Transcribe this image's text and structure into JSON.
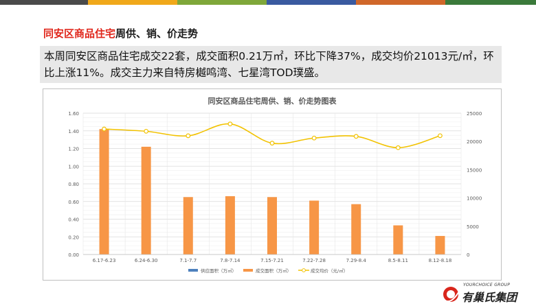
{
  "header": {
    "title_highlight": "同安区商品住宅",
    "title_rest": "周供、销、价走势"
  },
  "summary": {
    "text": "本周同安区商品住宅成交22套，成交面积0.21万㎡，环比下降37%，成交均价21013元/㎡，环比上涨11%。成交主力来自特房樾鸣湾、七星湾TOD璞盛。"
  },
  "chart_data": {
    "type": "bar",
    "title": "同安区商品住宅周供、销、价走势图表",
    "categories": [
      "6.17-6.23",
      "6.24-6.30",
      "7.1-7.7",
      "7.8-7.14",
      "7.15-7.21",
      "7.22-7.28",
      "7.29-8.4",
      "8.5-8.11",
      "8.12-8.18"
    ],
    "left_axis": {
      "ylim": [
        0,
        1.6
      ],
      "ticks": [
        "0.00",
        "0.20",
        "0.40",
        "0.60",
        "0.80",
        "1.00",
        "1.20",
        "1.40",
        "1.60"
      ]
    },
    "right_axis": {
      "ylim": [
        0,
        25000
      ],
      "ticks": [
        "0",
        "5000",
        "10000",
        "15000",
        "20000",
        "25000"
      ]
    },
    "series": [
      {
        "name": "供应面积（万㎡）",
        "kind": "bar",
        "axis": "left",
        "color": "#4e81bd",
        "values": [
          0,
          0,
          0,
          0,
          0,
          0,
          0,
          0,
          0
        ]
      },
      {
        "name": "成交面积（万㎡）",
        "kind": "bar",
        "axis": "left",
        "color": "#f79646",
        "values": [
          1.42,
          1.22,
          0.65,
          0.66,
          0.65,
          0.61,
          0.57,
          0.33,
          0.21
        ]
      },
      {
        "name": "成交均价（元/㎡）",
        "kind": "line",
        "axis": "right",
        "color": "#f2c200",
        "values": [
          22200,
          21800,
          21000,
          23100,
          19700,
          20600,
          20900,
          18900,
          21013
        ]
      }
    ],
    "grid": true,
    "legend": "bottom"
  },
  "logo": {
    "en": "YOURCHOICE GROUP",
    "cn": "有巢氏集团",
    "colors": {
      "mark": "#d9261c"
    }
  },
  "topbar_colors": [
    "#4a4a4a",
    "#f0a81a",
    "#7fa73a",
    "#3a5aa0",
    "#d0672a",
    "#3b7a3b",
    "#2d5aa8",
    "#333333"
  ]
}
